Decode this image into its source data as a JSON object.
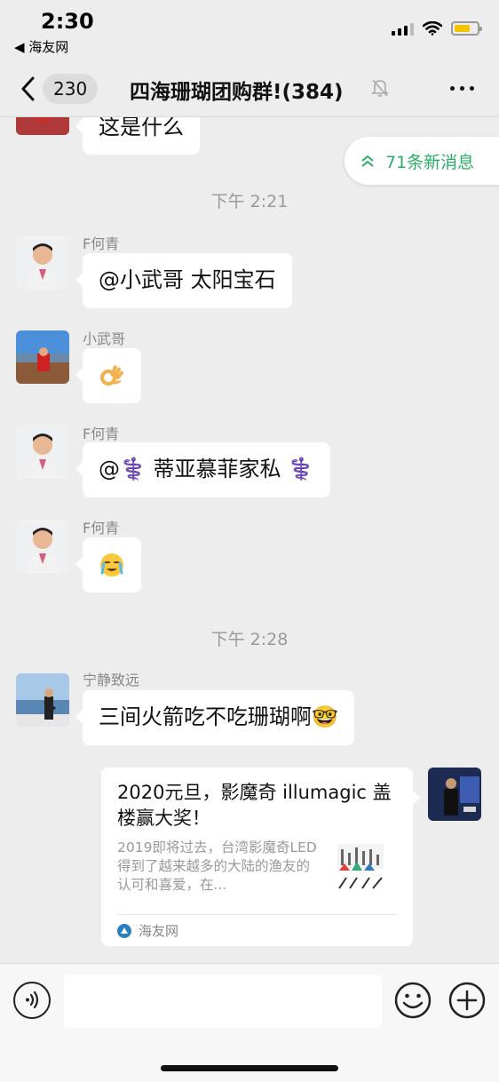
{
  "status_bar": {
    "time": "2:30",
    "back_app": "◀ 海友网"
  },
  "nav": {
    "unread_count": "230",
    "title": "四海珊瑚团购群!(384)"
  },
  "new_messages_label": "71条新消息",
  "messages": [
    {
      "type": "text",
      "sender": "",
      "text": "这是什么"
    },
    {
      "type": "time",
      "text": "下午 2:21"
    },
    {
      "type": "text",
      "sender": "F何青",
      "text": "@小武哥 太阳宝石"
    },
    {
      "type": "emoji",
      "sender": "小武哥",
      "emoji": "ok-hand-emoji"
    },
    {
      "type": "text",
      "sender": "F何青",
      "text": "@⚕️ 蒂亚慕菲家私 ⚕️"
    },
    {
      "type": "emoji",
      "sender": "F何青",
      "emoji": "crying-face-emoji"
    },
    {
      "type": "time",
      "text": "下午 2:28"
    },
    {
      "type": "text",
      "sender": "宁静致远",
      "text": "三间火箭吃不吃珊瑚啊🤓"
    },
    {
      "type": "link",
      "title": "2020元旦，影魔奇 illumagic 盖楼赢大奖！",
      "desc": "2019即将过去，台湾影魔奇LED得到了越来越多的大陆的渔友的认可和喜爱，在...",
      "source": "海友网"
    }
  ],
  "input": {
    "placeholder": ""
  },
  "colors": {
    "accent_green": "#2aae67",
    "background": "#ededed"
  }
}
